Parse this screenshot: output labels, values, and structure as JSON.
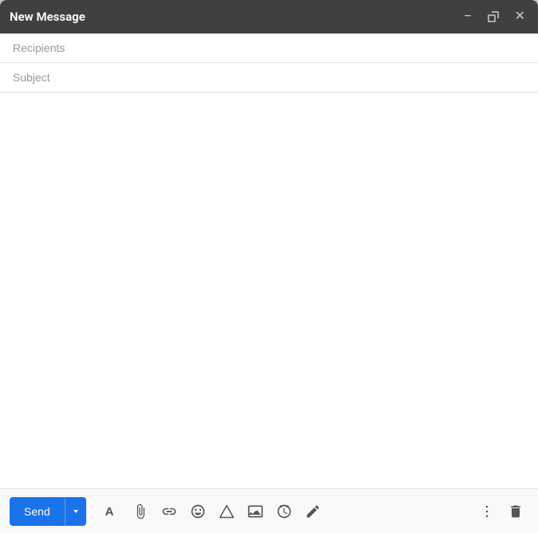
{
  "titlebar": {
    "title": "New Message",
    "minimize_label": "−",
    "maximize_label": "⤢",
    "close_label": "✕"
  },
  "fields": {
    "recipients_placeholder": "Recipients",
    "subject_placeholder": "Subject"
  },
  "body": {
    "placeholder": ""
  },
  "toolbar": {
    "send_label": "Send",
    "send_dropdown_label": "▾",
    "icons": [
      {
        "name": "formatting-icon",
        "symbol": "A",
        "title": "Formatting options"
      },
      {
        "name": "attach-icon",
        "symbol": "📎",
        "title": "Attach files"
      },
      {
        "name": "link-icon",
        "symbol": "🔗",
        "title": "Insert link"
      },
      {
        "name": "emoji-icon",
        "symbol": "😊",
        "title": "Insert emoji"
      },
      {
        "name": "drive-icon",
        "symbol": "△",
        "title": "Insert files using Drive"
      },
      {
        "name": "photo-icon",
        "symbol": "🖼",
        "title": "Insert photo"
      },
      {
        "name": "timer-icon",
        "symbol": "⏰",
        "title": "Toggle confidential mode"
      },
      {
        "name": "signature-icon",
        "symbol": "✒",
        "title": "Insert signature"
      }
    ],
    "more_options_label": "⋮",
    "delete_label": "🗑"
  }
}
